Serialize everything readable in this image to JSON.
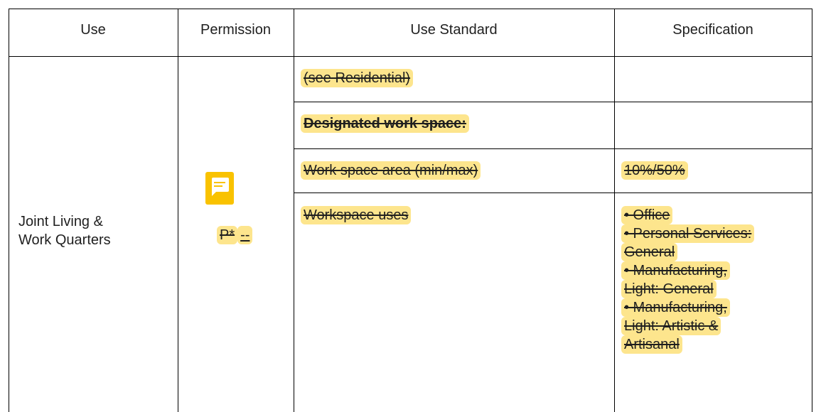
{
  "colors": {
    "highlight": "#fde58d",
    "comment": "#f9c200",
    "grid": "#000000"
  },
  "header": {
    "use": "Use",
    "permission": "Permission",
    "use_standard": "Use Standard",
    "specification": "Specification"
  },
  "row": {
    "use": [
      "Joint Living &",
      "Work Quarters"
    ],
    "permission_struck": "P*",
    "permission_inserted": "--",
    "comment_icon": "comment-icon"
  },
  "standards": [
    {
      "label": "(see Residential)",
      "spec": ""
    },
    {
      "label": "Designated work space:",
      "spec": ""
    },
    {
      "label": "Work space area (min/max)",
      "spec": "10%/50%"
    },
    {
      "label": "Workspace uses",
      "spec": ""
    }
  ],
  "workspace_uses_spec": [
    "• Office",
    "• Personal Services:",
    "General",
    "• Manufacturing,",
    "Light: General",
    "• Manufacturing,",
    "Light: Artistic &",
    "Artisanal"
  ]
}
